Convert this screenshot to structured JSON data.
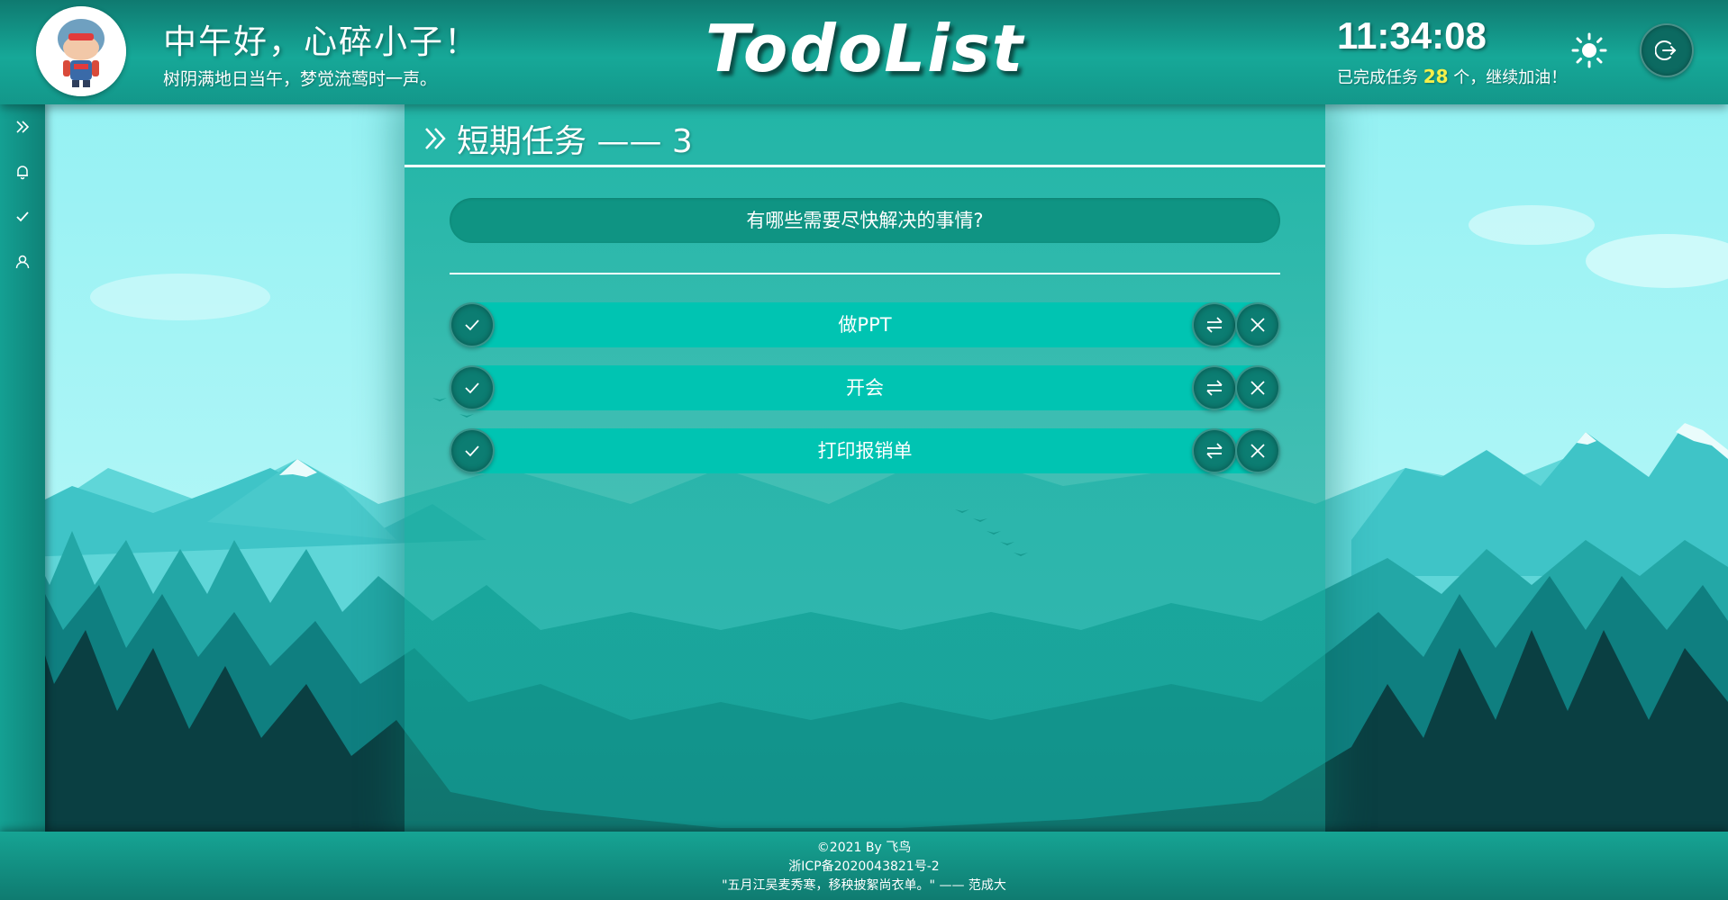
{
  "header": {
    "greeting": "中午好，心碎小子！",
    "poem": "树阴满地日当午，梦觉流莺时一声。",
    "logo": "TodoList",
    "time": "11:34:08",
    "completed_prefix": "已完成任务 ",
    "completed_count": "28",
    "completed_suffix": " 个，继续加油！"
  },
  "sidebar": {
    "items": [
      {
        "icon": "double-chevron-right-icon"
      },
      {
        "icon": "bell-icon"
      },
      {
        "icon": "check-icon"
      },
      {
        "icon": "user-icon"
      }
    ]
  },
  "main": {
    "title": "短期任务 —— 3",
    "input_placeholder": "有哪些需要尽快解决的事情?",
    "tasks": [
      {
        "text": "做PPT"
      },
      {
        "text": "开会"
      },
      {
        "text": "打印报销单"
      }
    ]
  },
  "footer": {
    "copyright": "©2021 By 飞鸟",
    "icp": "浙ICP备2020043821号-2",
    "quote": "\"五月江吴麦秀寒，移秧披絮尚衣单。\" —— 范成大"
  },
  "colors": {
    "header_bg": "#13978a",
    "task_bar": "#00c4b2",
    "count_highlight": "#f6f04a",
    "button_bg": "#0c7d72"
  }
}
